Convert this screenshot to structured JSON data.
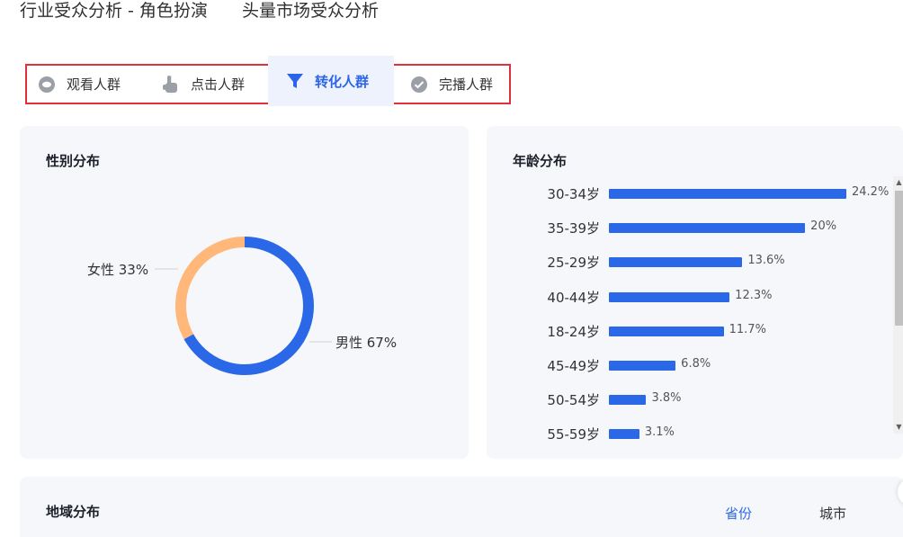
{
  "header": {
    "tabs": [
      {
        "label": "行业受众分析 - 角色扮演"
      },
      {
        "label": "头量市场受众分析"
      }
    ]
  },
  "audience_tabs": [
    {
      "label": "观看人群",
      "icon": "eye-icon",
      "active": false
    },
    {
      "label": "点击人群",
      "icon": "hand-pointer-icon",
      "active": false
    },
    {
      "label": "转化人群",
      "icon": "funnel-icon",
      "active": true
    },
    {
      "label": "完播人群",
      "icon": "check-circle-icon",
      "active": false
    }
  ],
  "colors": {
    "accent": "#2b68e8",
    "female": "#ffb77a",
    "card_bg": "#f5f7fb",
    "highlight_border": "#e0313a"
  },
  "gender": {
    "title": "性别分布",
    "female_label": "女性 33%",
    "male_label": "男性 67%"
  },
  "age": {
    "title": "年龄分布"
  },
  "region": {
    "title": "地域分布",
    "tab_province": "省份",
    "tab_city": "城市"
  },
  "chart_data": [
    {
      "type": "pie",
      "title": "性别分布",
      "categories": [
        "女性",
        "男性"
      ],
      "values": [
        33,
        67
      ],
      "colors": [
        "#ffb77a",
        "#2b68e8"
      ]
    },
    {
      "type": "bar",
      "title": "年龄分布",
      "orientation": "horizontal",
      "categories": [
        "30-34岁",
        "35-39岁",
        "25-29岁",
        "40-44岁",
        "18-24岁",
        "45-49岁",
        "50-54岁",
        "55-59岁"
      ],
      "values": [
        24.2,
        20,
        13.6,
        12.3,
        11.7,
        6.8,
        3.8,
        3.1
      ],
      "value_labels": [
        "24.2%",
        "20%",
        "13.6%",
        "12.3%",
        "11.7%",
        "6.8%",
        "3.8%",
        "3.1%"
      ],
      "unit": "%"
    }
  ]
}
